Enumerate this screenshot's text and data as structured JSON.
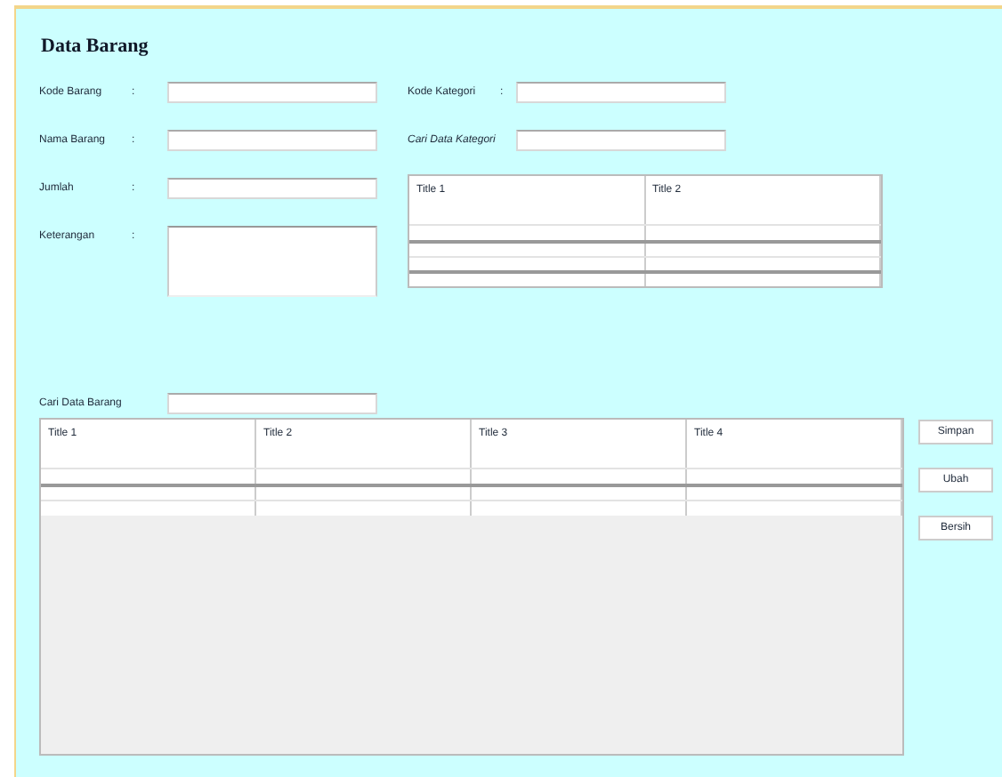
{
  "title": "Data Barang",
  "left_fields": [
    {
      "label": "Kode Barang",
      "colon": ":",
      "kind": "input"
    },
    {
      "label": "Nama Barang",
      "colon": ":",
      "kind": "input"
    },
    {
      "label": "Jumlah",
      "colon": ":",
      "kind": "input"
    },
    {
      "label": "Keterangan",
      "colon": ":",
      "kind": "textarea"
    }
  ],
  "right_fields": [
    {
      "label": "Kode Kategori",
      "colon": ":"
    },
    {
      "label": "Cari Data Kategori"
    }
  ],
  "category_table": {
    "columns": [
      "Title 1",
      "Title 2"
    ]
  },
  "search": {
    "label": "Cari Data Barang"
  },
  "item_table": {
    "columns": [
      "Title 1",
      "Title 2",
      "Title 3",
      "Title 4"
    ]
  },
  "buttons": [
    "Simpan",
    "Ubah",
    "Bersih"
  ]
}
